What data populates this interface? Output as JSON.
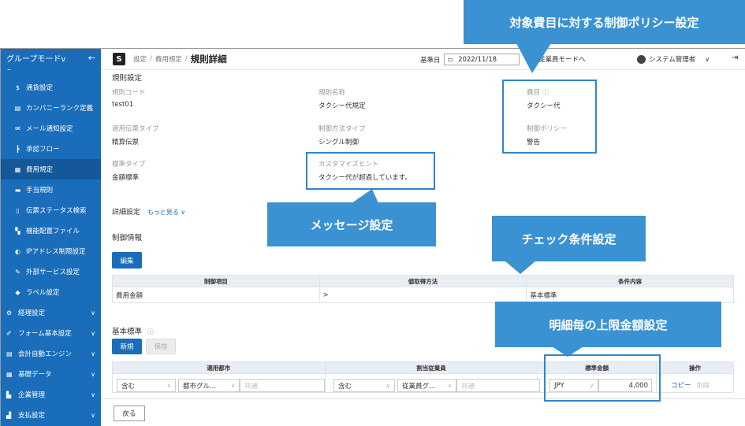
{
  "callouts": {
    "policy": "対象費目に対する制御ポリシー設定",
    "message": "メッセージ設定",
    "check": "チェック条件設定",
    "limit": "明細毎の上限金額設定"
  },
  "sidebar": {
    "mode_label": "グループモード",
    "mode_caret": "v",
    "collapse": "←",
    "dash": "–",
    "items": [
      {
        "label": "通貨設定",
        "icon": "currency-icon"
      },
      {
        "label": "カンパニーランク定義",
        "icon": "rank-icon"
      },
      {
        "label": "メール通知設定",
        "icon": "mail-icon"
      },
      {
        "label": "承認フロー",
        "icon": "flow-icon"
      },
      {
        "label": "費用規定",
        "icon": "rule-icon"
      },
      {
        "label": "手当規則",
        "icon": "allowance-icon"
      },
      {
        "label": "伝票ステータス検索",
        "icon": "document-search-icon"
      },
      {
        "label": "機能配置ファイル",
        "icon": "grid-icon"
      },
      {
        "label": "IPアドレス制限設定",
        "icon": "ip-icon"
      },
      {
        "label": "外部サービス設定",
        "icon": "plug-icon"
      },
      {
        "label": "ラベル設定",
        "icon": "label-icon"
      }
    ],
    "groups": [
      {
        "label": "経理設定",
        "icon": "gear-icon"
      },
      {
        "label": "フォーム基本設定",
        "icon": "wrench-icon"
      },
      {
        "label": "会計自動エンジン",
        "icon": "engine-icon"
      },
      {
        "label": "基礎データ",
        "icon": "database-icon"
      },
      {
        "label": "企業管理",
        "icon": "building-icon"
      },
      {
        "label": "支払設定",
        "icon": "payment-icon"
      }
    ]
  },
  "topbar": {
    "logo": "S",
    "crumb1": "設定",
    "crumb2": "費用規定",
    "sep": "/",
    "current": "規則詳細",
    "base_date_label": "基準日",
    "base_date": "2022/11/18",
    "employee_mode": "従業員モードへ",
    "user": "システム管理者",
    "chev": "∨",
    "logout": "⇥"
  },
  "rule": {
    "section": "規則設定",
    "code_label": "規則コード",
    "code": "test01",
    "name_label": "規則名称",
    "name": "タクシー代規定",
    "expense_label": "費目",
    "expense": "タクシー代",
    "doc_type_label": "適用伝票タイプ",
    "doc_type": "精算伝票",
    "control_type_label": "制御方法タイプ",
    "control_type": "シングル制御",
    "policy_label": "制御ポリシー",
    "policy": "警告",
    "standard_type_label": "標準タイプ",
    "standard_type": "金額標準",
    "hint_label": "カスタマイズヒント",
    "hint": "タクシー代が超過しています。"
  },
  "detail": {
    "label": "詳細設定",
    "more": "もっと見る",
    "control_info": "制御情報",
    "edit": "編集",
    "columns": [
      "制御項目",
      "値取得方法",
      "条件内容"
    ],
    "row": [
      "費用金額",
      ">",
      "基本標準"
    ]
  },
  "standard": {
    "label": "基本標準",
    "info": "i",
    "new": "新規",
    "save": "保存",
    "columns": [
      "適用都市",
      "割当従業員",
      "標準金額",
      "操作"
    ],
    "city_include": "含む",
    "city_group": "都市グル...",
    "city_common": "共通",
    "emp_include": "含む",
    "emp_group": "従業員グ...",
    "emp_common": "共通",
    "currency": "JPY",
    "amount": "4,000",
    "copy": "コピー",
    "delete": "削除"
  },
  "footer": {
    "back": "戻る"
  }
}
